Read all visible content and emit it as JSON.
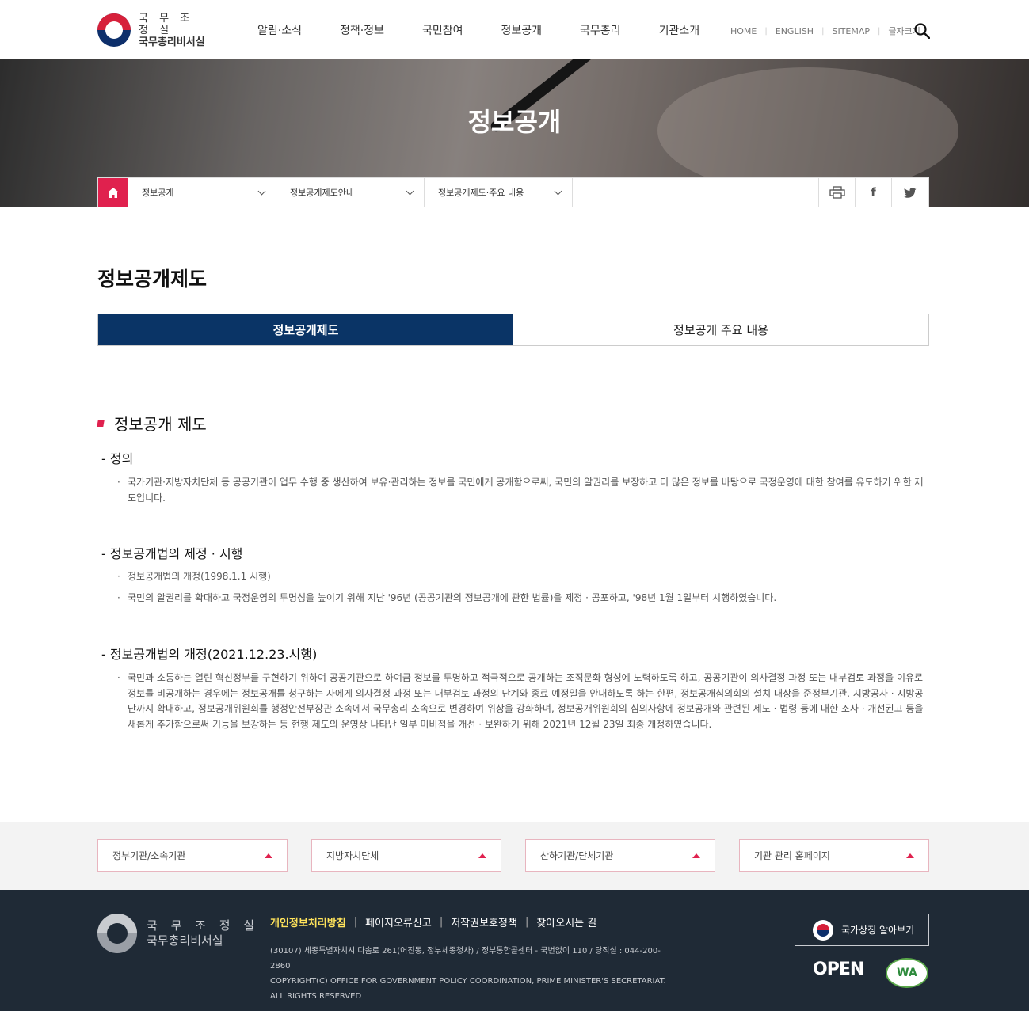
{
  "header": {
    "logo_line1": "국 무 조 정 실",
    "logo_line2": "국무총리비서실",
    "nav": [
      "알림·소식",
      "정책·정보",
      "국민참여",
      "정보공개",
      "국무총리",
      "기관소개"
    ],
    "util": [
      "HOME",
      "ENGLISH",
      "SITEMAP",
      "글자크기"
    ],
    "search_icon": "search-icon"
  },
  "banner": {
    "title": "정보공개"
  },
  "breadcrumb": {
    "items": [
      "정보공개",
      "정보공개제도안내",
      "정보공개제도·주요 내용"
    ],
    "icons": [
      "print-icon",
      "facebook-icon",
      "twitter-icon"
    ],
    "facebook_glyph": "f"
  },
  "main": {
    "page_title": "정보공개제도",
    "tabs": [
      {
        "label": "정보공개제도",
        "active": true
      },
      {
        "label": "정보공개 주요 내용",
        "active": false
      }
    ],
    "section_title": "정보공개 제도",
    "subsections": [
      {
        "title": "- 정의",
        "bullets": [
          "국가기관·지방자치단체 등 공공기관이 업무 수행 중 생산하여 보유·관리하는 정보를 국민에게 공개함으로써, 국민의 알권리를 보장하고 더 많은 정보를 바탕으로 국정운영에 대한 참여를 유도하기 위한 제도입니다."
        ]
      },
      {
        "title": "- 정보공개법의 제정 · 시행",
        "bullets": [
          "정보공개법의 개정(1998.1.1 시행)",
          "국민의 알권리를 확대하고 국정운영의 투명성을 높이기 위해 지난 '96년 (공공기관의 정보공개에 관한 법률)을 제정 · 공포하고, '98년 1월 1일부터 시행하였습니다."
        ]
      },
      {
        "title": "- 정보공개법의 개정(2021.12.23.시행)",
        "bullets": [
          "국민과 소통하는 열린 혁신정부를 구현하기 위하여 공공기관으로 하여금 정보를 투명하고 적극적으로 공개하는 조직문화 형성에 노력하도록 하고, 공공기관이 의사결정 과정 또는 내부검토 과정을 이유로 정보를 비공개하는 경우에는 정보공개를 청구하는 자에게 의사결정 과정 또는 내부검토 과정의 단계와 종료 예정일을 안내하도록 하는 한편, 정보공개심의회의 설치 대상을 준정부기관, 지방공사 · 지방공단까지 확대하고, 정보공개위원회를 행정안전부장관 소속에서 국무총리 소속으로 변경하여 위상을 강화하며, 정보공개위원회의 심의사항에 정보공개와 관련된 제도 · 법령 등에 대한 조사 · 개선권고 등을 새롭게 추가함으로써 기능을 보강하는 등 현행 제도의 운영상 나타난 일부 미비점을 개선 · 보완하기 위해 2021년 12월 23일 최종 개정하였습니다."
        ]
      }
    ]
  },
  "footer_links": [
    "정부기관/소속기관",
    "지방자치단체",
    "산하기관/단체기관",
    "기관 관리 홈페이지"
  ],
  "footer": {
    "logo_line1": "국 무 조 정 실",
    "logo_line2": "국무총리비서실",
    "menu": [
      "개인정보처리방침",
      "페이지오류신고",
      "저작권보호정책",
      "찾아오시는 길"
    ],
    "address": "(30107) 세종특별자치시 다솜로 261(어진동, 정부세종청사) / 정부통합콜센터 - 국번없이 110 / 당직실 : 044-200-2860",
    "copyright": "COPYRIGHT(C) OFFICE FOR GOVERNMENT POLICY COORDINATION, PRIME MINISTER'S SECRETARIAT. ALL RIGHTS RESERVED",
    "symbol_button": "국가상징 알아보기",
    "open_logo": "OPEN",
    "wa_logo": "WA"
  },
  "colors": {
    "accent": "#e0214e",
    "navy": "#0a3466",
    "footer_bg": "#1f2a36",
    "highlight": "#ffe35b"
  }
}
